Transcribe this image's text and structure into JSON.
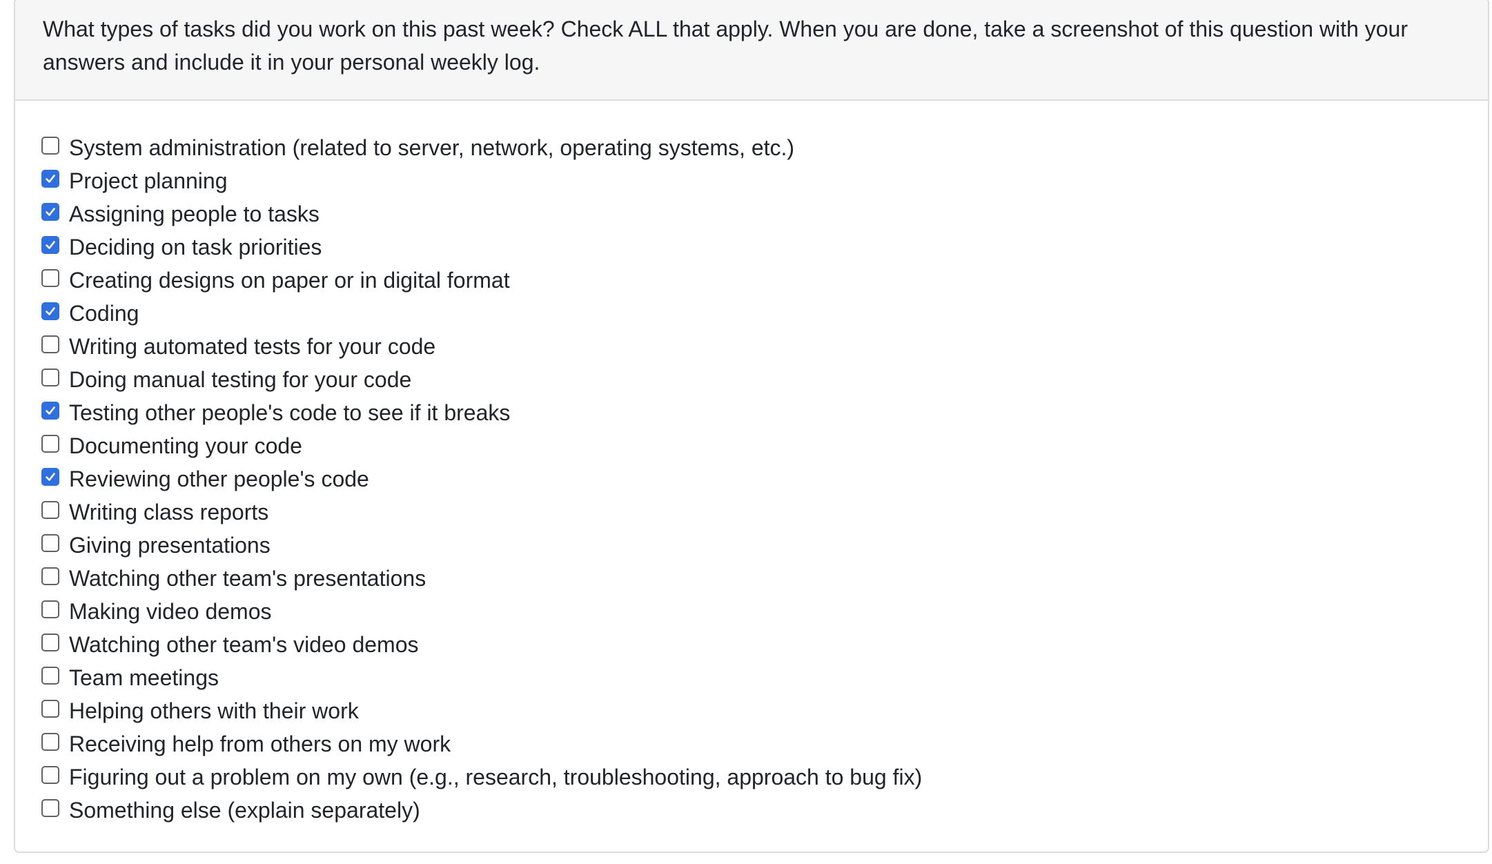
{
  "question": {
    "text": "What types of tasks did you work on this past week? Check ALL that apply. When you are done, take a screenshot of this question with your answers and include it in your personal weekly log.",
    "line1": "What types of tasks did you work on this past week? Check ALL that apply. When you are done, take a screenshot of this question with your",
    "line2": "answers and include it in your personal weekly log."
  },
  "options": [
    {
      "label": "System administration (related to server, network, operating systems, etc.)",
      "checked": false
    },
    {
      "label": "Project planning",
      "checked": true
    },
    {
      "label": "Assigning people to tasks",
      "checked": true
    },
    {
      "label": "Deciding on task priorities",
      "checked": true
    },
    {
      "label": "Creating designs on paper or in digital format",
      "checked": false
    },
    {
      "label": "Coding",
      "checked": true
    },
    {
      "label": "Writing automated tests for your code",
      "checked": false
    },
    {
      "label": "Doing manual testing for your code",
      "checked": false
    },
    {
      "label": "Testing other people's code to see if it breaks",
      "checked": true
    },
    {
      "label": "Documenting your code",
      "checked": false
    },
    {
      "label": "Reviewing other people's code",
      "checked": true
    },
    {
      "label": "Writing class reports",
      "checked": false
    },
    {
      "label": "Giving presentations",
      "checked": false
    },
    {
      "label": "Watching other team's presentations",
      "checked": false
    },
    {
      "label": "Making video demos",
      "checked": false
    },
    {
      "label": "Watching other team's video demos",
      "checked": false
    },
    {
      "label": "Team meetings",
      "checked": false
    },
    {
      "label": "Helping others with their work",
      "checked": false
    },
    {
      "label": "Receiving help from others on my work",
      "checked": false
    },
    {
      "label": "Figuring out a problem on my own (e.g., research, troubleshooting, approach to bug fix)",
      "checked": false
    },
    {
      "label": "Something else (explain separately)",
      "checked": false
    }
  ],
  "colors": {
    "checked": "#2f6fde",
    "header_bg": "#f6f6f6",
    "border": "#dcdcdc"
  },
  "icons": {
    "checked": "checkmark-icon"
  }
}
